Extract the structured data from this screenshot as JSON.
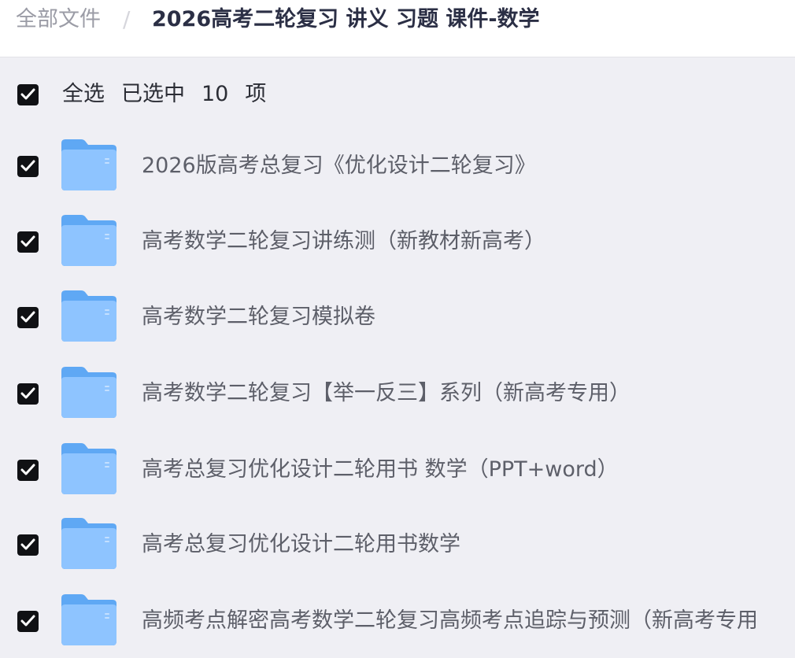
{
  "breadcrumb": {
    "root": "全部文件",
    "separator": "/",
    "current": "2026高考二轮复习 讲义 习题 课件-数学"
  },
  "selection": {
    "select_all_label": "全选",
    "selected_prefix": "已选中",
    "selected_count": "10",
    "selected_suffix": "项",
    "all_checked": true
  },
  "files": [
    {
      "name": "2026版高考总复习《优化设计二轮复习》",
      "checked": true,
      "icon": "folder-icon"
    },
    {
      "name": "高考数学二轮复习讲练测（新教材新高考）",
      "checked": true,
      "icon": "folder-icon"
    },
    {
      "name": "高考数学二轮复习模拟卷",
      "checked": true,
      "icon": "folder-icon"
    },
    {
      "name": "高考数学二轮复习【举一反三】系列（新高考专用）",
      "checked": true,
      "icon": "folder-icon"
    },
    {
      "name": "高考总复习优化设计二轮用书 数学（PPT+word）",
      "checked": true,
      "icon": "folder-icon"
    },
    {
      "name": "高考总复习优化设计二轮用书数学",
      "checked": true,
      "icon": "folder-icon"
    },
    {
      "name": "高频考点解密高考数学二轮复习高频考点追踪与预测（新高考专用",
      "checked": true,
      "icon": "folder-icon"
    }
  ],
  "colors": {
    "background": "#efeff4",
    "checkbox": "#101114",
    "folder_light": "#8ec4ff",
    "folder_dark": "#5fa8f4"
  }
}
